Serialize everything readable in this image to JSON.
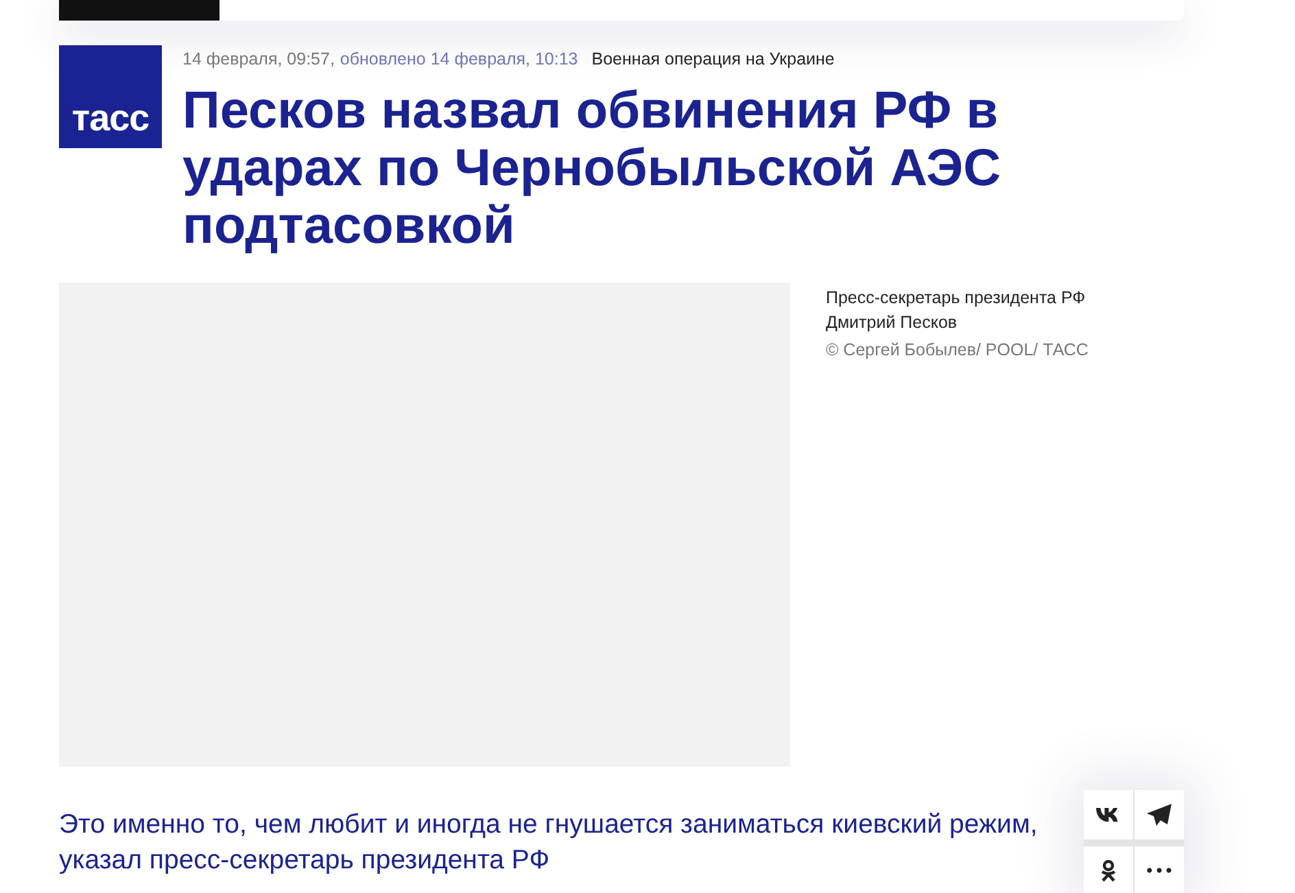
{
  "logo": {
    "text": "тасс"
  },
  "meta": {
    "published": "14 февраля, 09:57,",
    "updated": "обновлено 14 февраля, 10:13",
    "tag": "Военная операция на Украине"
  },
  "title": "Песков назвал обвинения РФ в ударах по Чернобыльской АЭС подтасовкой",
  "photo": {
    "caption": "Пресс-секретарь президента РФ Дмитрий Песков",
    "credit": "© Сергей Бобылев/ POOL/ ТАСС"
  },
  "lead": "Это именно то, чем любит и иногда не гнушается заниматься киевский режим, указал пресс-секретарь президента РФ",
  "share": [
    {
      "kind": "vk"
    },
    {
      "kind": "telegram"
    },
    {
      "kind": "ok"
    },
    {
      "kind": "more",
      "text": "•••"
    }
  ]
}
